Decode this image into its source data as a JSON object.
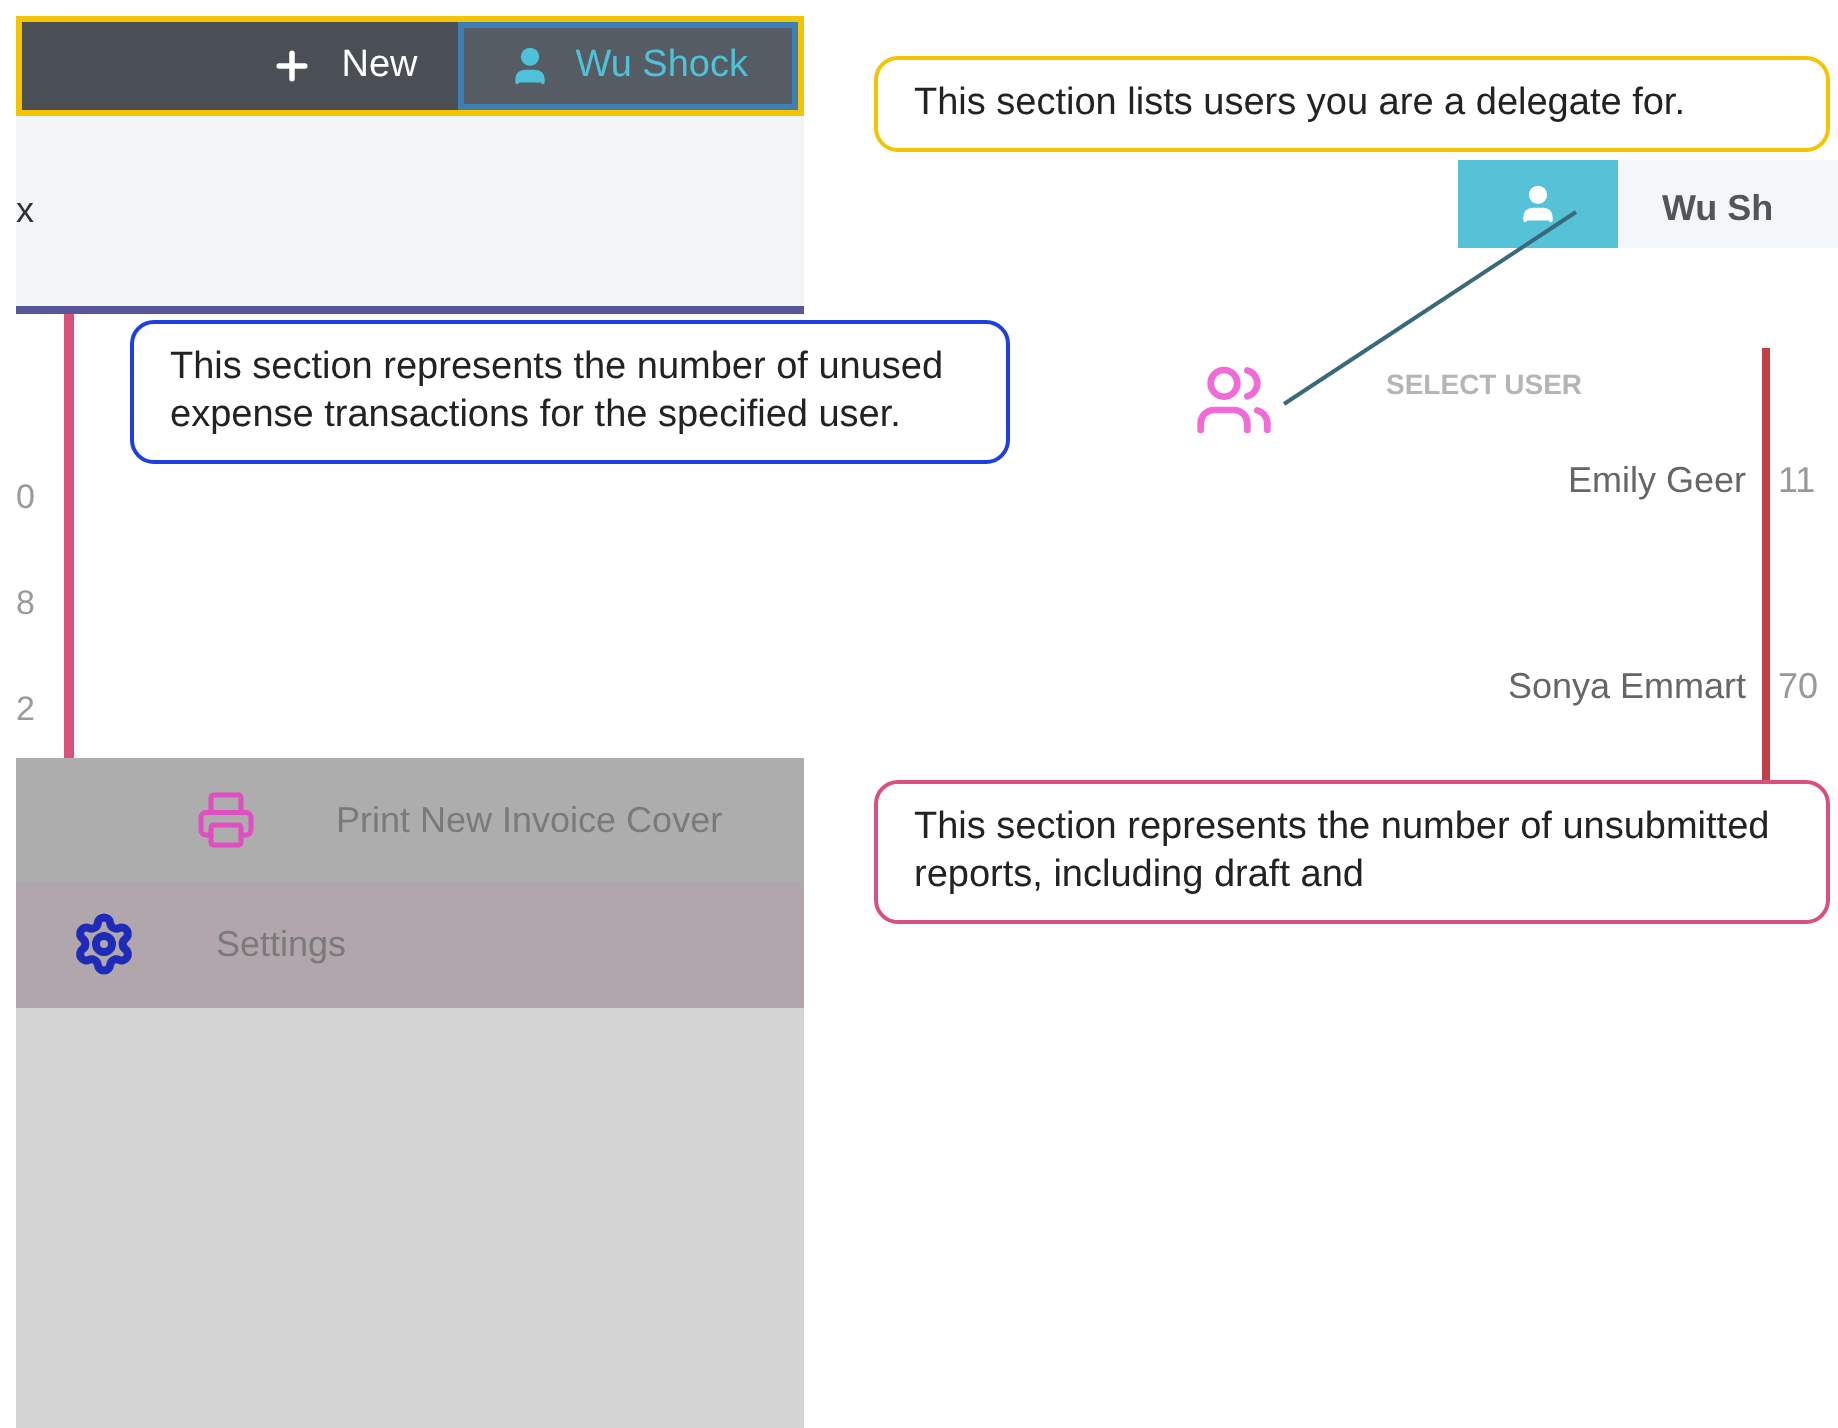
{
  "header": {
    "new_button": {
      "label": "New"
    },
    "user_tab": {
      "label": "Wu Shock",
      "selected": true
    }
  },
  "left_panel": {
    "text": "x"
  },
  "left_counts": [
    "0",
    "8",
    "2"
  ],
  "menu": [
    {
      "kind": "print",
      "label": "Print New Invoice Cover"
    },
    {
      "kind": "settings",
      "label": "Settings"
    }
  ],
  "user_card": {
    "name": "Wu Sh"
  },
  "user_select": {
    "heading": "SELECT USER",
    "users": [
      {
        "name": "Emily Geer",
        "count": "11"
      },
      {
        "name": "Sonya Emmart",
        "count": "70"
      }
    ]
  },
  "callouts": [
    {
      "color": "#f5c400",
      "text": "This section lists users you are a delegate for."
    },
    {
      "color": "#1f3fe0",
      "text": "This section represents the number of unused expense transactions for the specified user."
    },
    {
      "color": "#d9507a",
      "text": "This section represents the number of unsubmitted reports, including draft and"
    }
  ]
}
